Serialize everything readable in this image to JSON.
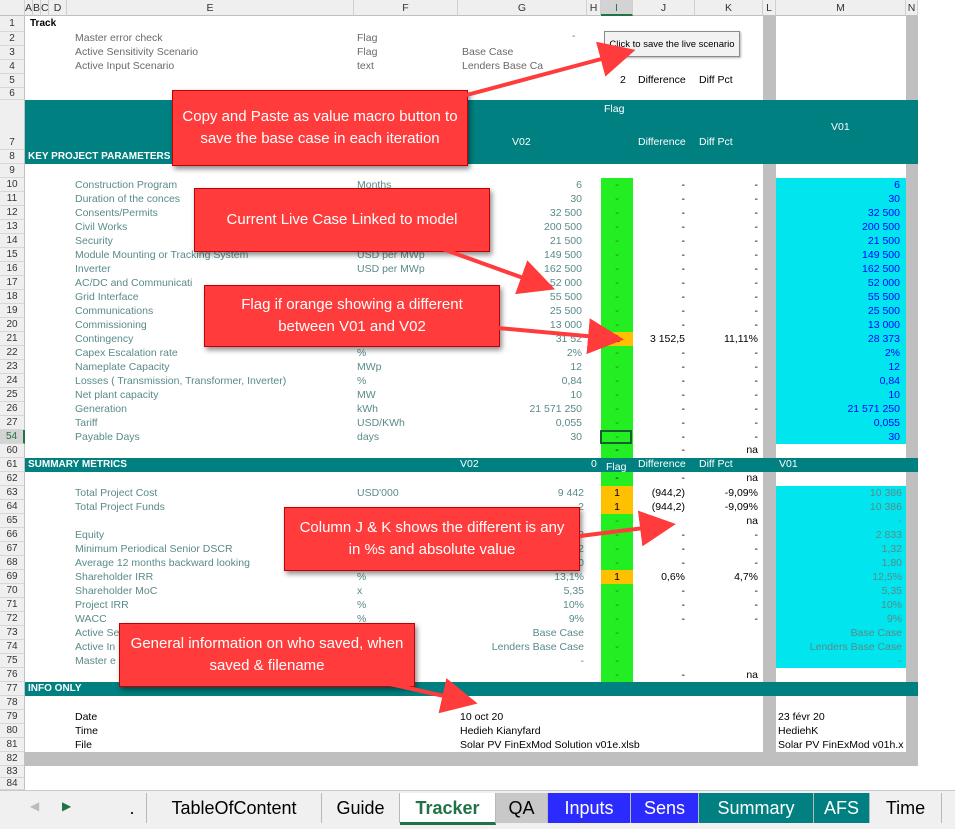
{
  "columns": {
    "headers": [
      "A",
      "B",
      "C",
      "D",
      "E",
      "F",
      "G",
      "H",
      "I",
      "J",
      "K",
      "L",
      "M",
      "N"
    ],
    "selected": "I"
  },
  "rows": {
    "labels": [
      "1",
      "2",
      "3",
      "4",
      "5",
      "6",
      "7",
      "8",
      "9",
      "10",
      "11",
      "12",
      "13",
      "14",
      "15",
      "16",
      "17",
      "18",
      "19",
      "20",
      "21",
      "22",
      "23",
      "24",
      "25",
      "26",
      "27",
      "54",
      "60",
      "61",
      "62",
      "63",
      "64",
      "65",
      "66",
      "67",
      "68",
      "69",
      "70",
      "71",
      "72",
      "73",
      "74",
      "75",
      "76",
      "77",
      "78",
      "79",
      "80",
      "81",
      "82",
      "83",
      "84"
    ]
  },
  "header_block": {
    "track": "Track",
    "master_error_check": "Master error check",
    "master_flag": "Flag",
    "master_value": "-",
    "active_sens": "Active Sensitivity Scenario",
    "active_sens_type": "Flag",
    "active_sens_value": "Base Case",
    "active_input": "Active Input Scenario",
    "active_input_type": "text",
    "active_input_value": "Lenders Base Ca",
    "row5_num": "2",
    "row5_diff": "Difference",
    "row5_pct": "Diff Pct",
    "macro_button": "Click to save the live scenario"
  },
  "band7": {
    "flag": "Flag",
    "v02": "V02",
    "v01": "V01",
    "difference": "Difference",
    "diff_pct": "Diff Pct",
    "section": "KEY PROJECT PARAMETERS"
  },
  "params": [
    {
      "label": "Construction Program",
      "unit": "Months",
      "v02": "6",
      "flag": "-",
      "diff": "-",
      "pct": "-",
      "v01": "6"
    },
    {
      "label": "Duration of the conces",
      "unit": "",
      "v02": "30",
      "flag": "-",
      "diff": "-",
      "pct": "-",
      "v01": "30"
    },
    {
      "label": "Consents/Permits",
      "unit": "",
      "v02": "32 500",
      "flag": "-",
      "diff": "-",
      "pct": "-",
      "v01": "32 500"
    },
    {
      "label": "Civil Works",
      "unit": "",
      "v02": "200 500",
      "flag": "-",
      "diff": "-",
      "pct": "-",
      "v01": "200 500"
    },
    {
      "label": "Security",
      "unit": "",
      "v02": "21 500",
      "flag": "-",
      "diff": "-",
      "pct": "-",
      "v01": "21 500"
    },
    {
      "label": "Module Mounting or Tracking System",
      "unit": "USD per MWp",
      "v02": "149 500",
      "flag": "-",
      "diff": "-",
      "pct": "-",
      "v01": "149 500"
    },
    {
      "label": "Inverter",
      "unit": "USD per MWp",
      "v02": "162 500",
      "flag": "-",
      "diff": "-",
      "pct": "-",
      "v01": "162 500"
    },
    {
      "label": "AC/DC and Communicati",
      "unit": "",
      "v02": "52 000",
      "flag": "-",
      "diff": "-",
      "pct": "-",
      "v01": "52 000"
    },
    {
      "label": "Grid Interface",
      "unit": "",
      "v02": "55 500",
      "flag": "-",
      "diff": "-",
      "pct": "-",
      "v01": "55 500"
    },
    {
      "label": "Communications",
      "unit": "",
      "v02": "25 500",
      "flag": "-",
      "diff": "-",
      "pct": "-",
      "v01": "25 500"
    },
    {
      "label": "Commissioning",
      "unit": "",
      "v02": "13 000",
      "flag": "-",
      "diff": "-",
      "pct": "-",
      "v01": "13 000"
    },
    {
      "label": "Contingency",
      "unit": "",
      "v02": "31 52",
      "flag": "1",
      "diff": "3 152,5",
      "pct": "11,11%",
      "v01": "28 373"
    },
    {
      "label": "Capex Escalation rate",
      "unit": "%",
      "v02": "2%",
      "flag": "-",
      "diff": "-",
      "pct": "-",
      "v01": "2%"
    },
    {
      "label": "Nameplate Capacity",
      "unit": "MWp",
      "v02": "12",
      "flag": "-",
      "diff": "-",
      "pct": "-",
      "v01": "12"
    },
    {
      "label": "Losses ( Transmission, Transformer, Inverter)",
      "unit": "%",
      "v02": "0,84",
      "flag": "-",
      "diff": "-",
      "pct": "-",
      "v01": "0,84"
    },
    {
      "label": "Net plant capacity",
      "unit": "MW",
      "v02": "10",
      "flag": "-",
      "diff": "-",
      "pct": "-",
      "v01": "10"
    },
    {
      "label": "Generation",
      "unit": "kWh",
      "v02": "21 571 250",
      "flag": "-",
      "diff": "-",
      "pct": "-",
      "v01": "21 571 250"
    },
    {
      "label": "Tariff",
      "unit": "USD/KWh",
      "v02": "0,055",
      "flag": "-",
      "diff": "-",
      "pct": "-",
      "v01": "0,055"
    },
    {
      "label": "Payable Days",
      "unit": "days",
      "v02": "30",
      "flag": "-",
      "diff": "-",
      "pct": "-",
      "v01": "30"
    }
  ],
  "row60": {
    "flag": "-",
    "diff": "-",
    "pct": "na"
  },
  "band61": {
    "section": "SUMMARY METRICS",
    "v02": "V02",
    "zero": "0",
    "flag": "Flag",
    "difference": "Difference",
    "diff_pct": "Diff Pct",
    "v01": "V01"
  },
  "row62": {
    "flag": "-",
    "diff": "-",
    "pct": "na"
  },
  "metrics": [
    {
      "label": "Total Project Cost",
      "unit": "USD'000",
      "v02": "9 442",
      "flag": "1",
      "diff": "(944,2)",
      "pct": "-9,09%",
      "v01": "10 386"
    },
    {
      "label": "Total Project Funds",
      "unit": "",
      "v02": "2",
      "flag": "1",
      "diff": "(944,2)",
      "pct": "-9,09%",
      "v01": "10 386"
    },
    {
      "label": "",
      "unit": "",
      "v02": "",
      "flag": "-",
      "diff": "",
      "pct": "na",
      "v01": "-"
    },
    {
      "label": "Equity",
      "unit": "",
      "v02": "3",
      "flag": "-",
      "diff": "-",
      "pct": "-",
      "v01": "2 833"
    },
    {
      "label": "Minimum  Periodical Senior DSCR",
      "unit": "",
      "v02": "2",
      "flag": "-",
      "diff": "-",
      "pct": "-",
      "v01": "1,32"
    },
    {
      "label": "Average  12 months backward looking",
      "unit": "",
      "v02": "0",
      "flag": "-",
      "diff": "-",
      "pct": "-",
      "v01": "1,80"
    },
    {
      "label": "Shareholder IRR",
      "unit": "%",
      "v02": "13,1%",
      "flag": "1",
      "diff": "0,6%",
      "pct": "4,7%",
      "v01": "12,5%"
    },
    {
      "label": "Shareholder MoC",
      "unit": "x",
      "v02": "5,35",
      "flag": "-",
      "diff": "-",
      "pct": "-",
      "v01": "5,35"
    },
    {
      "label": "Project IRR",
      "unit": "%",
      "v02": "10%",
      "flag": "-",
      "diff": "-",
      "pct": "-",
      "v01": "10%"
    },
    {
      "label": "WACC",
      "unit": "%",
      "v02": "9%",
      "flag": "-",
      "diff": "-",
      "pct": "-",
      "v01": "9%"
    },
    {
      "label": "Active Se",
      "unit": "",
      "v02": "Base Case",
      "flag": "-",
      "diff": "",
      "pct": "",
      "v01": "Base Case"
    },
    {
      "label": "Active In",
      "unit": "",
      "v02": "Lenders Base Case",
      "flag": "-",
      "diff": "",
      "pct": "",
      "v01": "Lenders Base Case"
    },
    {
      "label": "Master e",
      "unit": "",
      "v02": "-",
      "flag": "-",
      "diff": "",
      "pct": "",
      "v01": "-"
    },
    {
      "label": "",
      "unit": "",
      "v02": "",
      "flag": "-",
      "diff": "-",
      "pct": "na",
      "v01": ""
    }
  ],
  "band77": {
    "section": "INFO ONLY"
  },
  "info": [
    {
      "label": "Date",
      "v02": "10 oct 20",
      "v01": "23 févr 20"
    },
    {
      "label": "Time",
      "v02": "Hedieh Kianyfard",
      "v01": "HediehK"
    },
    {
      "label": "File",
      "v02": "Solar PV  FinExMod  Solution  v01e.xlsb",
      "v01": "Solar PV  FinExMod  v01h.x"
    }
  ],
  "callouts": {
    "macro": "Copy and Paste as value macro button to save the base case in each iteration",
    "live": "Current Live Case Linked to model",
    "flag": "Flag if orange showing a different between V01 and V02",
    "columns": "Column J & K shows the different is any in %s and absolute value",
    "info": "General information on who saved, when saved & filename"
  },
  "tabs": [
    {
      "label": ".",
      "bg": "#f0f0f0",
      "color": "#000000"
    },
    {
      "label": "TableOfContent",
      "bg": "#f0f0f0",
      "color": "#000000"
    },
    {
      "label": "Guide",
      "bg": "#f0f0f0",
      "color": "#000000"
    },
    {
      "label": "Tracker",
      "bg": "#ffffff",
      "color": "#217346"
    },
    {
      "label": "QA",
      "bg": "#c8c8c8",
      "color": "#000000"
    },
    {
      "label": "Inputs",
      "bg": "#2b2bff",
      "color": "#ffffff"
    },
    {
      "label": "Sens",
      "bg": "#2b2bff",
      "color": "#ffffff"
    },
    {
      "label": "Summary",
      "bg": "#008080",
      "color": "#ffffff"
    },
    {
      "label": "AFS",
      "bg": "#008080",
      "color": "#ffffff"
    },
    {
      "label": "Time",
      "bg": "#f0f0f0",
      "color": "#000000"
    }
  ],
  "colors": {
    "band": "#008080",
    "flag_green": "#22ee22",
    "flag_orange": "#ffc000",
    "v01_cyan": "#00e5ee",
    "callout_red": "#ff3b3b"
  },
  "nav": {
    "left": "◀",
    "right": "▶"
  }
}
